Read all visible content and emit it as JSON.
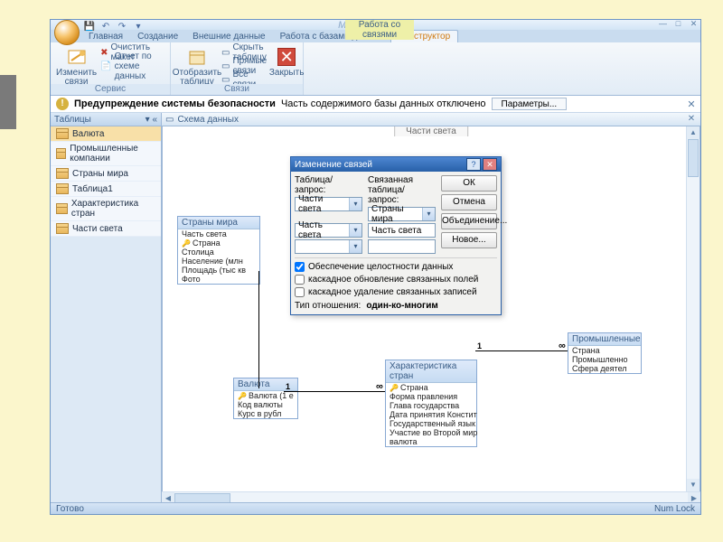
{
  "app": {
    "title": "Microsoft Access",
    "context_tab_group": "Работа со связями"
  },
  "tabs": {
    "home": "Главная",
    "create": "Создание",
    "external": "Внешние данные",
    "dbtools": "Работа с базами данных",
    "design": "Конструктор"
  },
  "ribbon": {
    "edit_rel": "Изменить\nсвязи",
    "clear_layout": "Очистить макет",
    "rel_report": "Отчет по схеме данных",
    "show_table": "Отобразить\nтаблицу",
    "hide_table": "Скрыть таблицу",
    "direct_rel": "Прямые связи",
    "all_rel": "Все связи",
    "close": "Закрыть",
    "grp_service": "Сервис",
    "grp_rel": "Связи"
  },
  "warning": {
    "title": "Предупреждение системы безопасности",
    "text": "Часть содержимого базы данных отключено",
    "btn": "Параметры..."
  },
  "nav": {
    "header": "Таблицы",
    "items": [
      "Валюта",
      "Промышленные компании",
      "Страны мира",
      "Таблица1",
      "Характеристика стран",
      "Части света"
    ]
  },
  "canvas": {
    "title": "Схема данных",
    "fake_tab": "Части света"
  },
  "tables": {
    "countries": {
      "title": "Страны мира",
      "fields": [
        "Часть света",
        "Страна",
        "Столица",
        "Население (млн",
        "Площадь (тыс кв",
        "Фото"
      ]
    },
    "currency": {
      "title": "Валюта",
      "fields": [
        "Валюта (1 е",
        "Код валюты",
        "Курс в рубл"
      ]
    },
    "char": {
      "title": "Характеристика стран",
      "fields": [
        "Страна",
        "Форма правления",
        "Глава государства",
        "Дата принятия Констит",
        "Государственный язык",
        "Участие во Второй мир",
        "валюта"
      ]
    },
    "ind": {
      "title": "Промышленные",
      "fields": [
        "Страна",
        "Промышленно",
        "Сфера деятел"
      ]
    }
  },
  "dialog": {
    "title": "Изменение связей",
    "lbl_table": "Таблица/запрос:",
    "lbl_related": "Связанная таблица/запрос:",
    "left_table": "Части света",
    "right_table": "Страны мира",
    "left_field": "Часть света",
    "right_field": "Часть света",
    "chk_integrity": "Обеспечение целостности данных",
    "chk_cascade_upd": "каскадное обновление связанных полей",
    "chk_cascade_del": "каскадное удаление связанных записей",
    "lbl_reltype": "Тип отношения:",
    "reltype": "один-ко-многим",
    "btn_ok": "ОК",
    "btn_cancel": "Отмена",
    "btn_join": "Объединение...",
    "btn_new": "Новое..."
  },
  "status": {
    "left": "Готово",
    "right": "Num Lock"
  }
}
